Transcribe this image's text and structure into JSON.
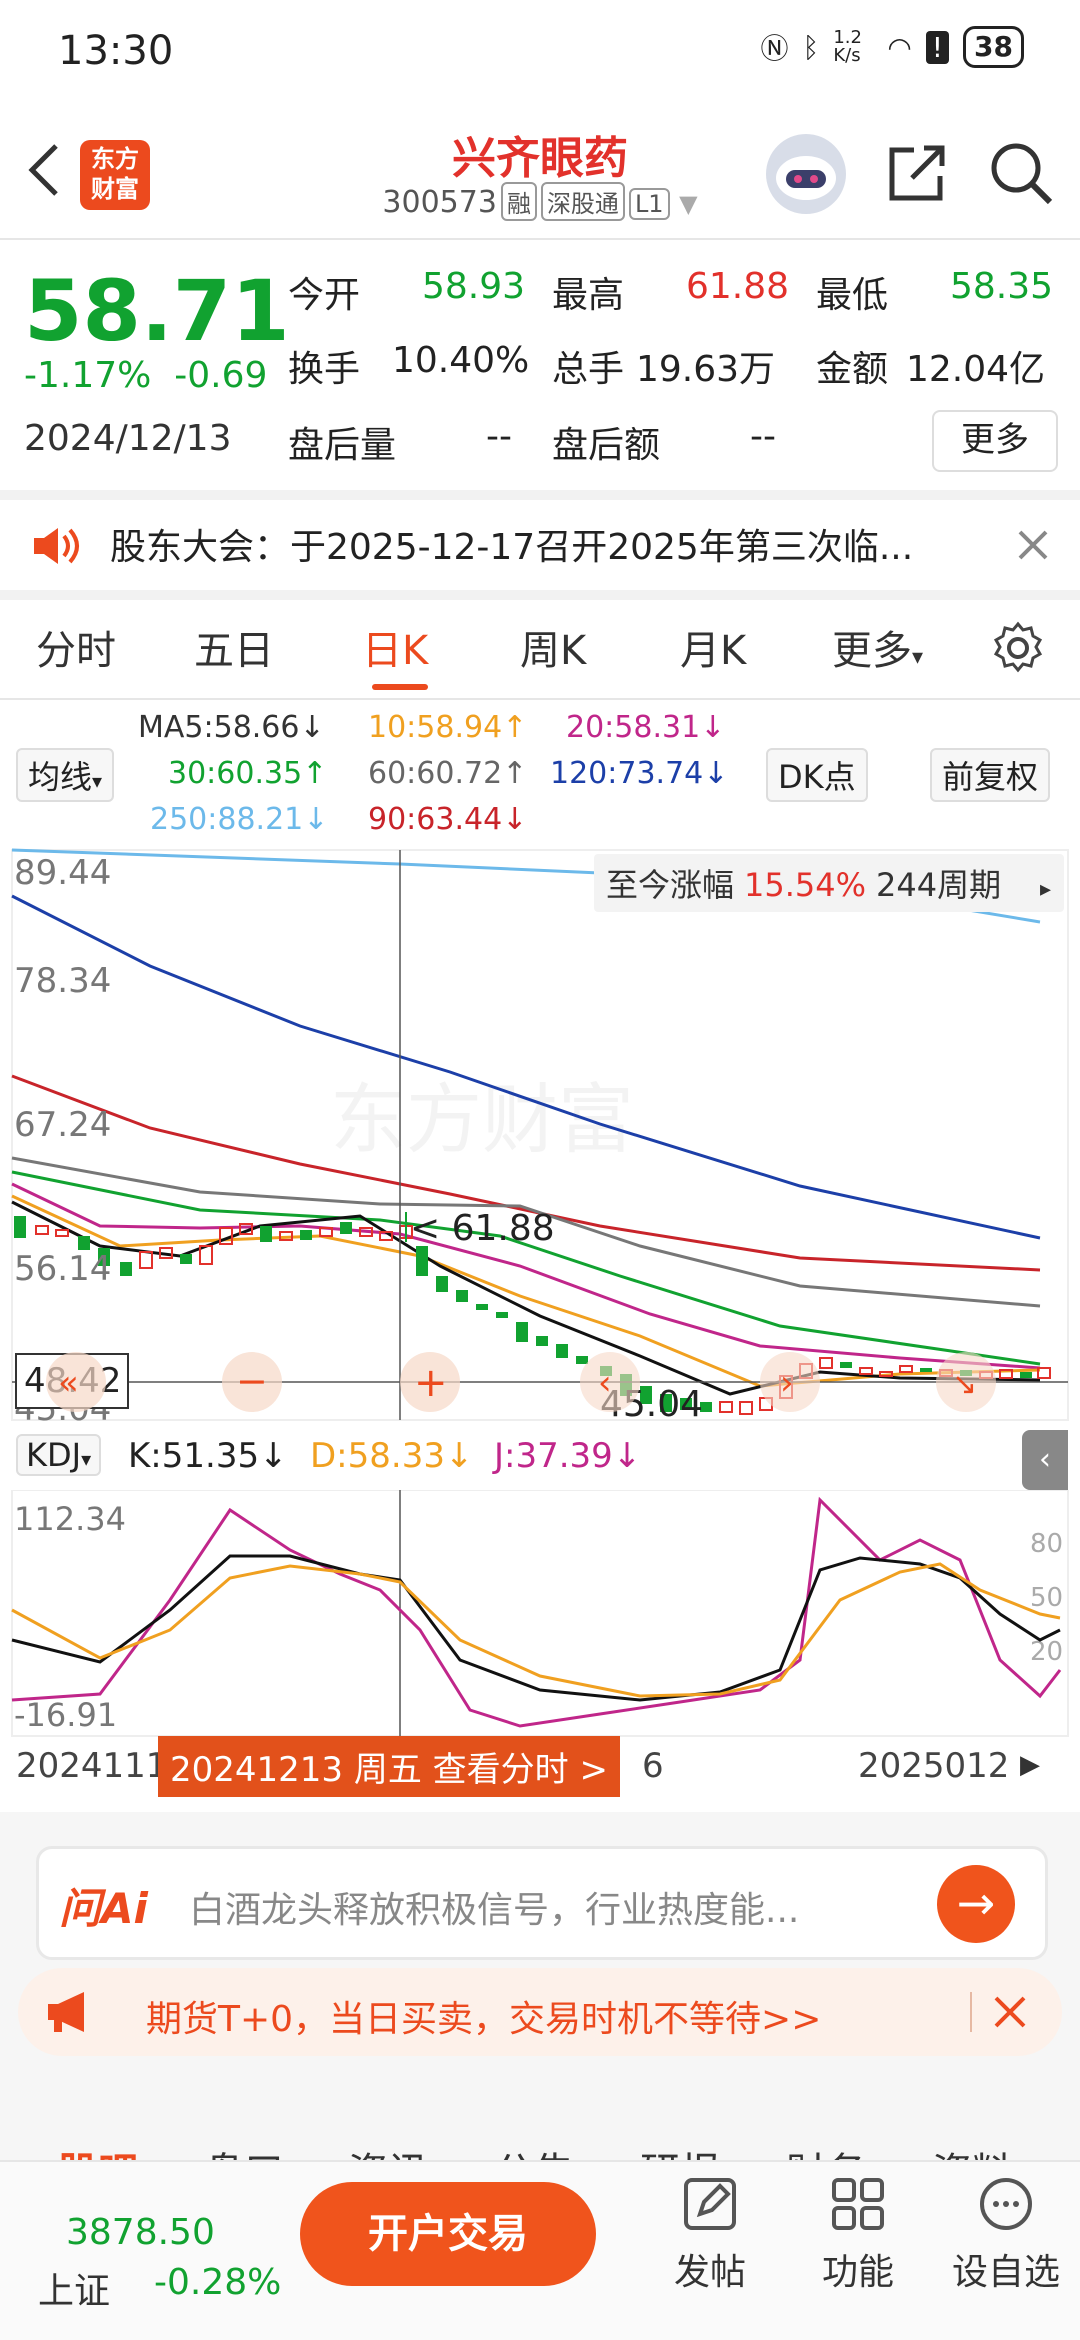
{
  "status_bar": {
    "time": "13:30",
    "net_speed": "1.2 K/s",
    "battery": "38"
  },
  "header": {
    "title": "兴齐眼药",
    "code": "300573",
    "tags": [
      "融",
      "深股通",
      "L1"
    ],
    "logo_text": "东方财富"
  },
  "quote": {
    "price": "58.71",
    "change_pct": "-1.17%",
    "change_amt": "-0.69",
    "date": "2024/12/13",
    "open_label": "今开",
    "open": "58.93",
    "high_label": "最高",
    "high": "61.88",
    "low_label": "最低",
    "low": "58.35",
    "turnover_label": "换手",
    "turnover": "10.40%",
    "volume_label": "总手",
    "volume": "19.63万",
    "amount_label": "金额",
    "amount": "12.04亿",
    "after_vol_label": "盘后量",
    "after_vol": "--",
    "after_amt_label": "盘后额",
    "after_amt": "--",
    "more": "更多"
  },
  "notice": {
    "text": "股东大会：于2025-12-17召开2025年第三次临..."
  },
  "tabs": [
    "分时",
    "五日",
    "日K",
    "周K",
    "月K",
    "更多"
  ],
  "ma": {
    "selector": "均线",
    "ma5": "MA5:58.66↓",
    "ma10": "10:58.94↑",
    "ma20": "20:58.31↓",
    "ma30": "30:60.35↑",
    "ma60": "60:60.72↑",
    "ma120": "120:73.74↓",
    "ma250": "250:88.21↓",
    "ma90": "90:63.44↓",
    "dk": "DK点",
    "fq": "前复权"
  },
  "chart": {
    "y_labels": [
      "89.44",
      "78.34",
      "67.24",
      "56.14",
      "45.04"
    ],
    "crosshair_value": "48.42",
    "high_marker": "61.88",
    "low_marker": "45.04",
    "range_label": "至今涨幅",
    "range_pct": "15.54%",
    "range_period": "244周期",
    "watermark": "东方财富"
  },
  "kdj": {
    "selector": "KDJ",
    "k": "K:51.35↓",
    "d": "D:58.33↓",
    "j": "J:37.39↓",
    "y_top": "112.34",
    "y_bottom": "-16.91",
    "r80": "80",
    "r50": "50",
    "r20": "20"
  },
  "x_axis": {
    "left": "2024111",
    "right": "2025012",
    "mid": "6",
    "tooltip": "20241213 周五 查看分时 >"
  },
  "ai": {
    "brand": "问Ai",
    "placeholder": "白酒龙头释放积极信号，行业热度能..."
  },
  "promo": {
    "text": "期货T+0，当日买卖，交易时机不等待>>"
  },
  "section_tabs": [
    "股吧",
    "盘口",
    "资讯",
    "公告",
    "研报",
    "财务",
    "资料"
  ],
  "bottom": {
    "index_value": "3878.50",
    "index_name": "上证",
    "index_change": "-0.28%",
    "trade": "开户交易",
    "post": "发帖",
    "func": "功能",
    "watch": "设自选"
  },
  "colors": {
    "up": "#e2312b",
    "down": "#11a230",
    "accent": "#ec4a1e"
  }
}
